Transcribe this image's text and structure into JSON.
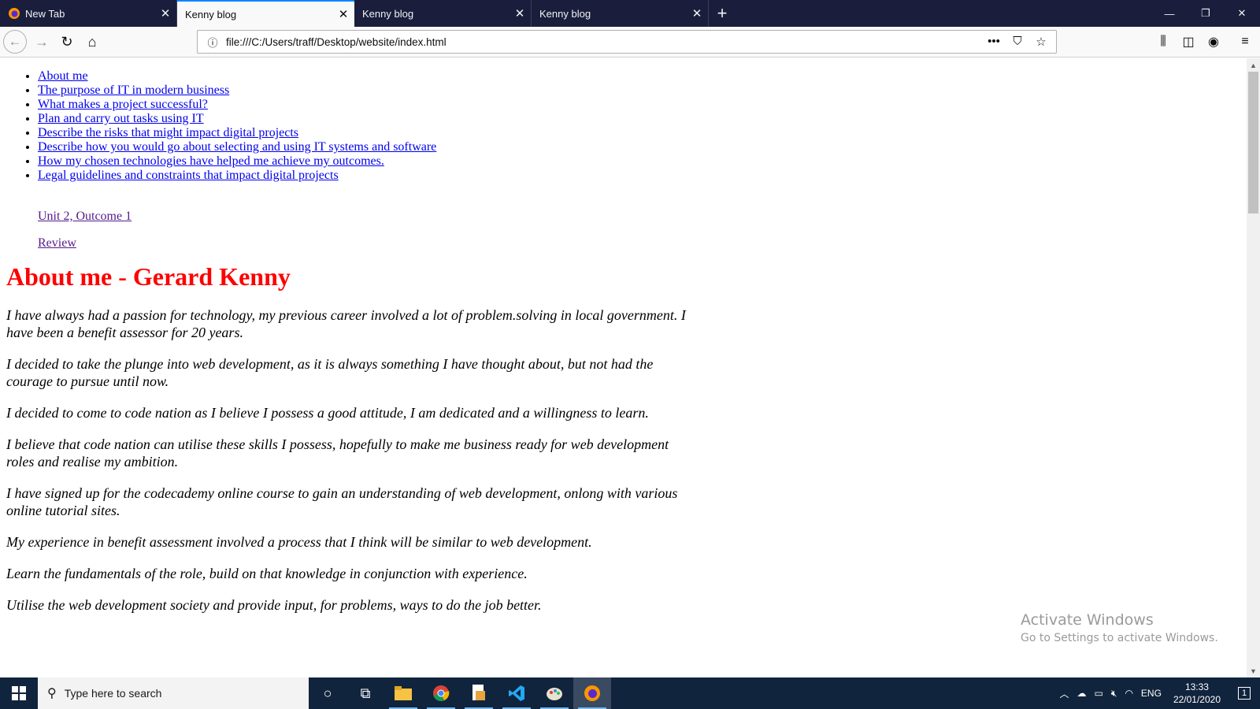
{
  "browser": {
    "tabs": [
      {
        "title": "New Tab",
        "selected": false
      },
      {
        "title": "Kenny blog",
        "selected": true
      },
      {
        "title": "Kenny blog",
        "selected": false
      },
      {
        "title": "Kenny blog",
        "selected": false
      }
    ],
    "new_tab_symbol": "+",
    "url": "file:///C:/Users/traff/Desktop/website/index.html"
  },
  "page": {
    "nav_links": [
      "About me",
      "The purpose of IT in modern business",
      "What makes a project successful?",
      "Plan and carry out tasks using IT",
      "Describe the risks that might impact digital projects",
      "Describe how you would go about selecting and using IT systems and software",
      "How my chosen technologies have helped me achieve my outcomes.",
      "Legal guidelines and constraints that impact digital projects"
    ],
    "sub_links": [
      "Unit 2, Outcome 1",
      "Review"
    ],
    "heading": "About me - Gerard Kenny",
    "paragraphs": [
      "I have always had a passion for technology, my previous career involved a lot of problem.solving in local government. I have been a benefit assessor for 20 years.",
      "I decided to take the plunge into web development, as it is always something I have thought about, but not had the courage to pursue until now.",
      "I decided to come to code nation as I believe I possess a good attitude, I am dedicated and a willingness to learn.",
      "I believe that code nation can utilise these skills I possess, hopefully to make me business ready for web development roles and realise my ambition.",
      "I have signed up for the codecademy online course to gain an understanding of web development, onlong with various online tutorial sites.",
      "My experience in benefit assessment involved a process that I think will be similar to web development.",
      "Learn the fundamentals of the role, build on that knowledge in conjunction with experience.",
      "Utilise the web development society and provide input, for problems, ways to do the job better."
    ],
    "heading_color": "#ff0000"
  },
  "watermark": {
    "line1": "Activate Windows",
    "line2": "Go to Settings to activate Windows."
  },
  "taskbar": {
    "search_placeholder": "Type here to search",
    "language": "ENG",
    "time": "13:33",
    "date": "22/01/2020",
    "notification_count": "1"
  }
}
